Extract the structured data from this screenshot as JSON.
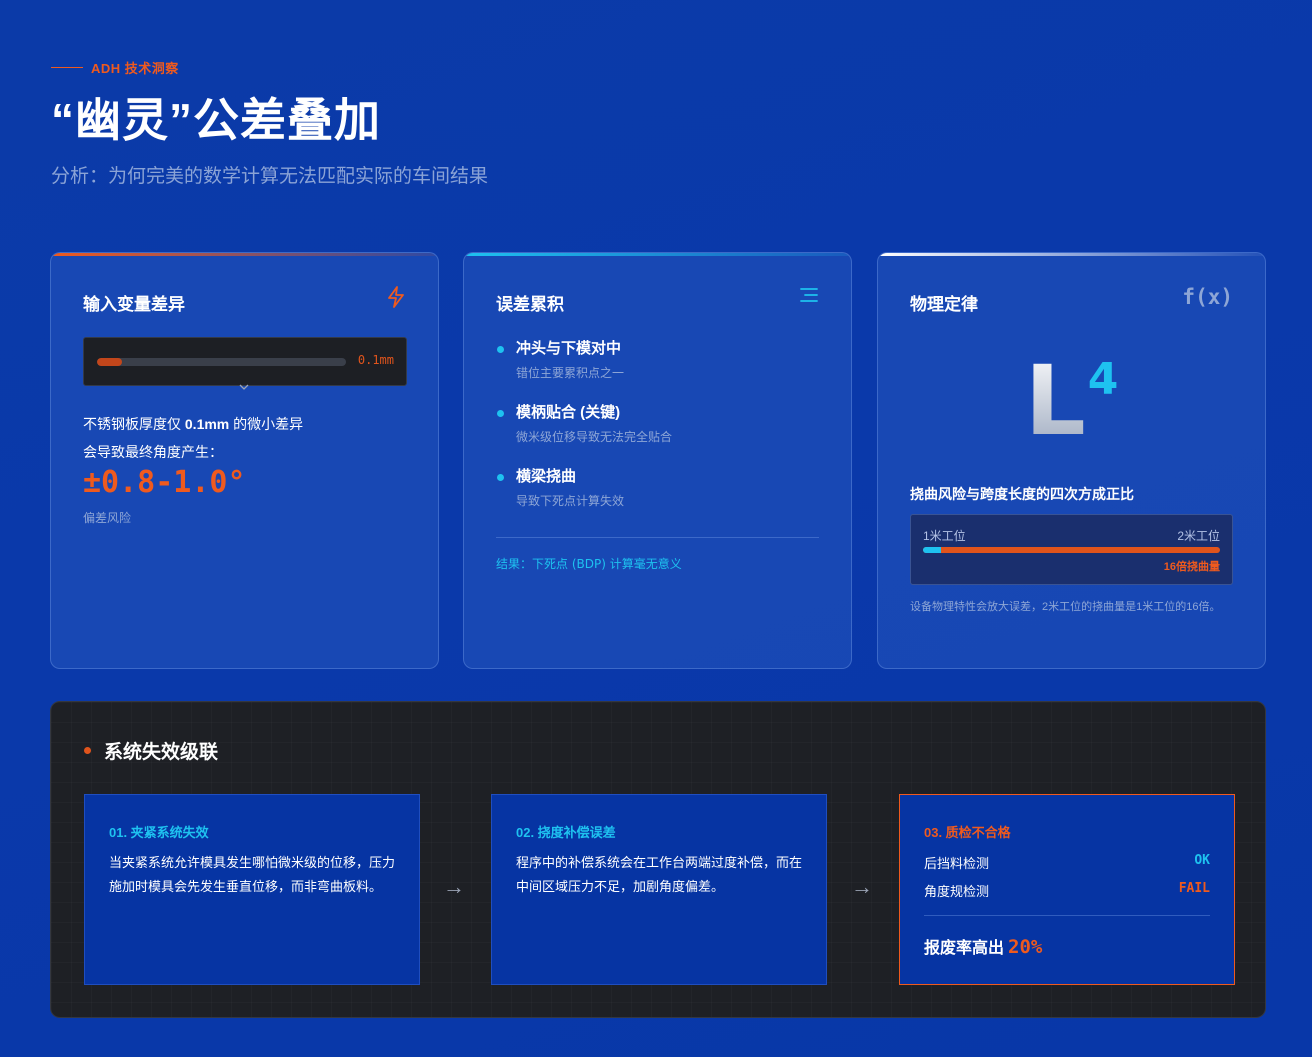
{
  "header": {
    "eyebrow": "ADH 技术洞察",
    "title": "“幽灵”公差叠加",
    "subtitle": "分析：为何完美的数学计算无法匹配实际的车间结果"
  },
  "cards": {
    "input": {
      "title": "输入变量差异",
      "icon": "lightning-icon",
      "gauge_value": "0.1mm",
      "gauge_fill_percent": 10,
      "text_line1_pre": "不锈钢板厚度仅 ",
      "text_line1_bold": "0.1mm",
      "text_line1_post": " 的微小差异",
      "text_line2": "会导致最终角度产生：",
      "big_value": "±0.8-1.0°",
      "footnote": "偏差风险"
    },
    "accumulation": {
      "title": "误差累积",
      "icon": "list-icon",
      "items": [
        {
          "title": "冲头与下模对中",
          "sub": "错位主要累积点之一"
        },
        {
          "title": "模柄贴合 (关键)",
          "sub": "微米级位移导致无法完全贴合"
        },
        {
          "title": "横梁挠曲",
          "sub": "导致下死点计算失效"
        }
      ],
      "result": "结果：下死点 (BDP) 计算毫无意义"
    },
    "physics": {
      "title": "物理定律",
      "icon_text": "f(x)",
      "formula_base": "L",
      "formula_exp": "4",
      "label": "挠曲风险与跨度长度的四次方成正比",
      "bar_left": "1米工位",
      "bar_right": "2米工位",
      "bar_ratio_percent": 6,
      "bar_note": "16倍挠曲量",
      "footnote": "设备物理特性会放大误差，2米工位的挠曲量是1米工位的16倍。"
    }
  },
  "cascade": {
    "title": "系统失效级联",
    "steps": [
      {
        "title": "01. 夹紧系统失效",
        "body": "当夹紧系统允许模具发生哪怕微米级的位移，压力施加时模具会先发生垂直位移，而非弯曲板料。"
      },
      {
        "title": "02. 挠度补偿误差",
        "body": "程序中的补偿系统会在工作台两端过度补偿，而在中间区域压力不足，加剧角度偏差。"
      },
      {
        "title": "03. 质检不合格",
        "checks": [
          {
            "label": "后挡料检测",
            "value": "OK"
          },
          {
            "label": "角度规检测",
            "value": "FAIL"
          }
        ],
        "scrap_label": "报废率高出",
        "scrap_value": "20%"
      }
    ],
    "arrow": "→"
  },
  "colors": {
    "accent_orange": "#ef5a1e",
    "accent_cyan": "#1ec2f0",
    "background_blue": "#0a39aa",
    "panel_dark": "#1e2025"
  }
}
